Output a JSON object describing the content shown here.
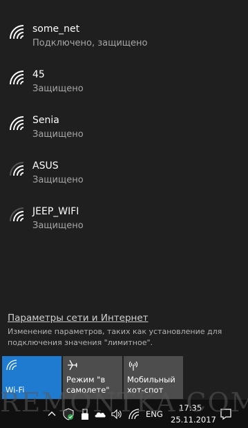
{
  "networks": [
    {
      "ssid": "some_net",
      "status": "Подключено, защищено",
      "icon": "wifi-full-icon"
    },
    {
      "ssid": "45",
      "status": "Защищено",
      "icon": "wifi-full-icon"
    },
    {
      "ssid": "Senia",
      "status": "Защищено",
      "icon": "wifi-full-icon"
    },
    {
      "ssid": "ASUS",
      "status": "Защищено",
      "icon": "wifi-medium-icon"
    },
    {
      "ssid": "JEEP_WIFI",
      "status": "Защищено",
      "icon": "wifi-medium-icon"
    }
  ],
  "settings": {
    "link": "Параметры сети и Интернет",
    "description": "Изменение параметров, таких как установление для подключения значения \"лимитное\"."
  },
  "tiles": {
    "wifi": "Wi-Fi",
    "airplane": "Режим \"в самолете\"",
    "hotspot": "Мобильный хот-спот"
  },
  "taskbar": {
    "language": "ENG",
    "time": "17:35",
    "date": "25.11.2017"
  },
  "watermark": "REMONTKA.COM",
  "colors": {
    "accent": "#1e7bd0",
    "tile": "#4d4d4d",
    "background": "#1f1f1f"
  }
}
